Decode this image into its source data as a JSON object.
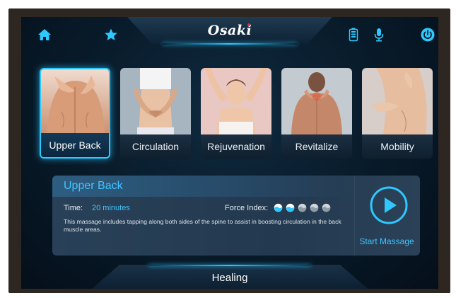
{
  "header": {
    "logo_text": "Osaki",
    "logo_accent_color": "#e03030",
    "icons": {
      "home": "home-icon",
      "favorite": "star-icon",
      "battery": "battery-icon",
      "voice": "microphone-icon",
      "power": "power-icon"
    }
  },
  "programs": [
    {
      "label": "Upper Back",
      "selected": true,
      "image": "upper-back-photo"
    },
    {
      "label": "Circulation",
      "selected": false,
      "image": "circulation-photo"
    },
    {
      "label": "Rejuvenation",
      "selected": false,
      "image": "rejuvenation-photo"
    },
    {
      "label": "Revitalize",
      "selected": false,
      "image": "revitalize-photo"
    },
    {
      "label": "Mobility",
      "selected": false,
      "image": "mobility-photo"
    }
  ],
  "details": {
    "title": "Upper Back",
    "time_label": "Time:",
    "time_value": "20 minutes",
    "force_label": "Force Index:",
    "force_level": 2,
    "force_max": 5,
    "description": "This massage includes tapping along both sides of the spine to assist in boosting circulation in the back muscle areas.",
    "start_label": "Start Massage"
  },
  "footer": {
    "label": "Healing"
  },
  "colors": {
    "accent": "#41c3ff",
    "glow": "#27c9ff",
    "background": "#081a29"
  }
}
